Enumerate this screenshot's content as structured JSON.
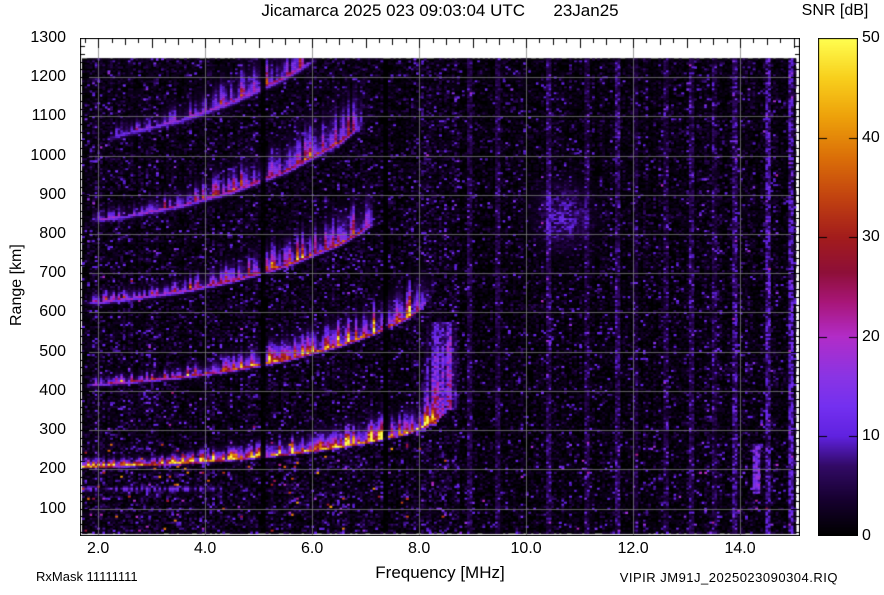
{
  "header": {
    "title": "Jicamarca 2025 023 09:03:04 UTC      23Jan25",
    "colorbar_title": "SNR [dB]"
  },
  "footer": {
    "rx_mask": "RxMask 11111111",
    "axis_label": "Frequency [MHz]",
    "file_id": "VIPIR JM91J_2025023090304.RIQ"
  },
  "chart_data": {
    "type": "heatmap",
    "subtype": "ionogram",
    "station": "Jicamarca",
    "timestamp_utc": "2025 023 09:03:04 UTC",
    "date": "23Jan25",
    "title": "Jicamarca 2025 023 09:03:04 UTC      23Jan25",
    "xlabel": "Frequency [MHz]",
    "ylabel": "Range [km]",
    "colorbar_label": "SNR [dB]",
    "xlim_mhz": [
      1.66,
      15.12
    ],
    "ylim_km": [
      30,
      1300
    ],
    "snr_lim_db": [
      0,
      50
    ],
    "xtick_values": [
      2,
      4,
      6,
      8,
      10,
      12,
      14
    ],
    "xtick_labels": [
      "2.0",
      "4.0",
      "6.0",
      "8.0",
      "10.0",
      "12.0",
      "14.0"
    ],
    "ytick_values": [
      100,
      200,
      300,
      400,
      500,
      600,
      700,
      800,
      900,
      1000,
      1100,
      1200,
      1300
    ],
    "ytick_labels": [
      "100",
      "200",
      "300",
      "400",
      "500",
      "600",
      "700",
      "800",
      "900",
      "1000",
      "1100",
      "1200",
      "1300"
    ],
    "colorbar_tick_values": [
      0,
      10,
      20,
      30,
      40,
      50
    ],
    "colorbar_tick_labels": [
      "0",
      "10",
      "20",
      "30",
      "40",
      "50"
    ],
    "axis_ticks": {
      "x_minor_mhz": 0.25,
      "y_minor_km": 20
    },
    "grid": {
      "shown": true,
      "x_step_mhz": 2,
      "y_step_km": 100,
      "color": "#7d7d7d"
    },
    "data_extent": {
      "f_mhz": [
        1.67,
        15.06
      ],
      "range_km": [
        36,
        1248
      ]
    },
    "critical_frequency_foF2_mhz": 8.6,
    "colormap_stops": [
      [
        0.0,
        "#000000"
      ],
      [
        0.07,
        "#16002e"
      ],
      [
        0.14,
        "#320a66"
      ],
      [
        0.2,
        "#6022e0"
      ],
      [
        0.26,
        "#7430f0"
      ],
      [
        0.32,
        "#8a34e4"
      ],
      [
        0.4,
        "#b22cc8"
      ],
      [
        0.47,
        "#a81678"
      ],
      [
        0.53,
        "#8e0f38"
      ],
      [
        0.6,
        "#a31c1c"
      ],
      [
        0.68,
        "#c24310"
      ],
      [
        0.76,
        "#db6f08"
      ],
      [
        0.84,
        "#eda00a"
      ],
      [
        0.92,
        "#f8cf1c"
      ],
      [
        1.0,
        "#ffff50"
      ]
    ],
    "echo_traces": [
      {
        "n": 1,
        "name": "F-region first hop",
        "f_range": [
          1.66,
          8.55
        ],
        "intensity_db": 46,
        "points": [
          [
            1.66,
            208
          ],
          [
            2.5,
            212
          ],
          [
            3.5,
            218
          ],
          [
            4.5,
            228
          ],
          [
            5.5,
            241
          ],
          [
            6.5,
            259
          ],
          [
            7.2,
            276
          ],
          [
            7.8,
            295
          ],
          [
            8.1,
            312
          ],
          [
            8.35,
            335
          ],
          [
            8.55,
            365
          ]
        ]
      },
      {
        "n": 2,
        "name": "second hop",
        "f_range": [
          1.66,
          8.35
        ],
        "intensity_db": 36,
        "points": [
          [
            1.66,
            416
          ],
          [
            2.5,
            424
          ],
          [
            3.5,
            437
          ],
          [
            4.5,
            456
          ],
          [
            5.5,
            482
          ],
          [
            6.5,
            518
          ],
          [
            7.2,
            552
          ],
          [
            7.8,
            590
          ],
          [
            8.1,
            624
          ],
          [
            8.35,
            670
          ]
        ]
      },
      {
        "n": 3,
        "name": "third hop",
        "f_range": [
          1.66,
          7.3
        ],
        "intensity_db": 30,
        "points": [
          [
            1.66,
            624
          ],
          [
            2.5,
            636
          ],
          [
            3.5,
            655
          ],
          [
            4.5,
            684
          ],
          [
            5.5,
            723
          ],
          [
            6.5,
            777
          ],
          [
            7.3,
            840
          ]
        ]
      },
      {
        "n": 4,
        "name": "fourth hop",
        "f_range": [
          1.75,
          7.1
        ],
        "intensity_db": 26,
        "points": [
          [
            1.75,
            835
          ],
          [
            2.5,
            848
          ],
          [
            3.5,
            874
          ],
          [
            4.5,
            912
          ],
          [
            5.5,
            964
          ],
          [
            6.5,
            1036
          ],
          [
            7.1,
            1100
          ]
        ]
      },
      {
        "n": 5,
        "name": "fifth hop",
        "f_range": [
          2.05,
          6.2
        ],
        "intensity_db": 22,
        "points": [
          [
            2.05,
            1042
          ],
          [
            2.5,
            1060
          ],
          [
            3.5,
            1092
          ],
          [
            4.5,
            1140
          ],
          [
            5.5,
            1205
          ],
          [
            6.2,
            1260
          ]
        ]
      }
    ],
    "features": {
      "e_layer": {
        "range_km": 150,
        "f_range_mhz": [
          1.66,
          4.35
        ],
        "intensity_db": 10
      },
      "spread_f": {
        "f_range_mhz": [
          7.95,
          8.72
        ],
        "range_km": [
          300,
          570
        ],
        "peak_intensity_db": 34
      },
      "diffuse_echo": {
        "center_f_mhz": 10.7,
        "center_range_km": 845,
        "sigma_f_mhz": 0.5,
        "sigma_range_km": 80,
        "intensity_db": 11
      },
      "rfi_lines": [
        {
          "f_mhz": 8.95,
          "db": 5
        },
        {
          "f_mhz": 9.45,
          "db": 5
        },
        {
          "f_mhz": 10.4,
          "db": 5
        },
        {
          "f_mhz": 11.15,
          "db": 4
        },
        {
          "f_mhz": 11.7,
          "db": 6
        },
        {
          "f_mhz": 12.05,
          "db": 4
        },
        {
          "f_mhz": 12.6,
          "db": 4
        },
        {
          "f_mhz": 13.1,
          "db": 5
        },
        {
          "f_mhz": 13.55,
          "db": 4
        },
        {
          "f_mhz": 13.9,
          "db": 6
        },
        {
          "f_mhz": 14.55,
          "db": 8
        },
        {
          "f_mhz": 14.97,
          "db": 9
        }
      ],
      "rfi_burst": {
        "f_mhz": 14.32,
        "range_km": [
          140,
          265
        ],
        "db": 14
      },
      "absorption_notches_mhz": [
        5.08,
        7.38
      ],
      "noise_floor_db": 2.2,
      "low_altitude_speckle": {
        "max_range_km": 268,
        "cluster_freqs_mhz": [
          2.6,
          3.5,
          5.55,
          6.55
        ],
        "max_db": 42
      }
    }
  }
}
